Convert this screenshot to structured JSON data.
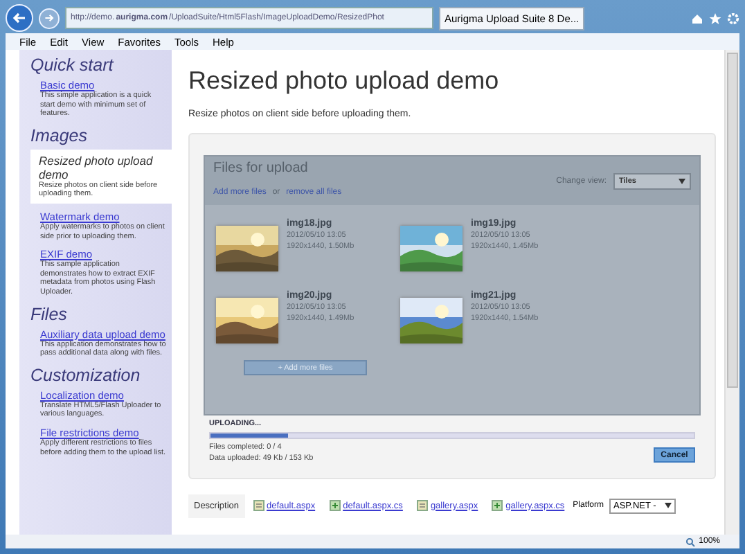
{
  "browser": {
    "url_prefix": "http://demo.",
    "url_domain": "aurigma.com",
    "url_rest": "/UploadSuite/Html5Flash/ImageUploadDemo/ResizedPhot",
    "tab_title": "Aurigma Upload Suite 8 De...",
    "zoom": "100%"
  },
  "menu": [
    "File",
    "Edit",
    "View",
    "Favorites",
    "Tools",
    "Help"
  ],
  "sidebar": [
    {
      "heading": "Quick start",
      "items": [
        {
          "title": "Basic demo",
          "text": "This simple application is a quick start demo with minimum set of features.",
          "selected": false
        }
      ]
    },
    {
      "heading": "Images",
      "items": [
        {
          "title": "Resized photo upload demo",
          "text": "Resize photos on client side before uploading them.",
          "selected": true
        },
        {
          "title": "Watermark demo",
          "text": "Apply watermarks to photos on client side prior to uploading them.",
          "selected": false
        },
        {
          "title": "EXIF demo",
          "text": "This sample application demonstrates how to extract EXIF metadata from photos using Flash Uploader.",
          "selected": false
        }
      ]
    },
    {
      "heading": "Files",
      "items": [
        {
          "title": "Auxiliary data upload demo",
          "text": "This application demonstrates how to pass additional data along with files.",
          "selected": false
        }
      ]
    },
    {
      "heading": "Customization",
      "items": [
        {
          "title": "Localization demo",
          "text": "Translate HTML5/Flash Uploader to various languages.",
          "selected": false
        },
        {
          "title": "File restrictions demo",
          "text": "Apply different restrictions to files before adding them to the upload list.",
          "selected": false
        }
      ]
    }
  ],
  "page": {
    "title": "Resized photo upload demo",
    "subtitle": "Resize photos on client side before uploading them."
  },
  "uploader": {
    "title": "Files for upload",
    "add_link": "Add more files",
    "or": "or",
    "remove_link": "remove all files",
    "view_label": "Change view:",
    "view_value": "Tiles",
    "files": [
      {
        "name": "img18.jpg",
        "date": "2012/05/10 13:05",
        "info": "1920x1440, 1.50Mb"
      },
      {
        "name": "img19.jpg",
        "date": "2012/05/10 13:05",
        "info": "1920x1440, 1.45Mb"
      },
      {
        "name": "img20.jpg",
        "date": "2012/05/10 13:05",
        "info": "1920x1440, 1.49Mb"
      },
      {
        "name": "img21.jpg",
        "date": "2012/05/10 13:05",
        "info": "1920x1440, 1.54Mb"
      }
    ],
    "add_button": "+ Add more files",
    "status": "UPLOADING...",
    "level": 0.16,
    "files_completed": "Files completed: 0 / 4",
    "data_uploaded": "Data uploaded: 49 Kb / 153 Kb",
    "cancel": "Cancel"
  },
  "source_tabs": [
    {
      "label": "Description",
      "kind": "plain",
      "selected": true
    },
    {
      "label": "default.aspx",
      "kind": "page",
      "selected": false
    },
    {
      "label": "default.aspx.cs",
      "kind": "code",
      "selected": false
    },
    {
      "label": "gallery.aspx",
      "kind": "page",
      "selected": false
    },
    {
      "label": "gallery.aspx.cs",
      "kind": "code",
      "selected": false
    }
  ],
  "platform": {
    "label": "Platform",
    "value": "ASP.NET -"
  }
}
